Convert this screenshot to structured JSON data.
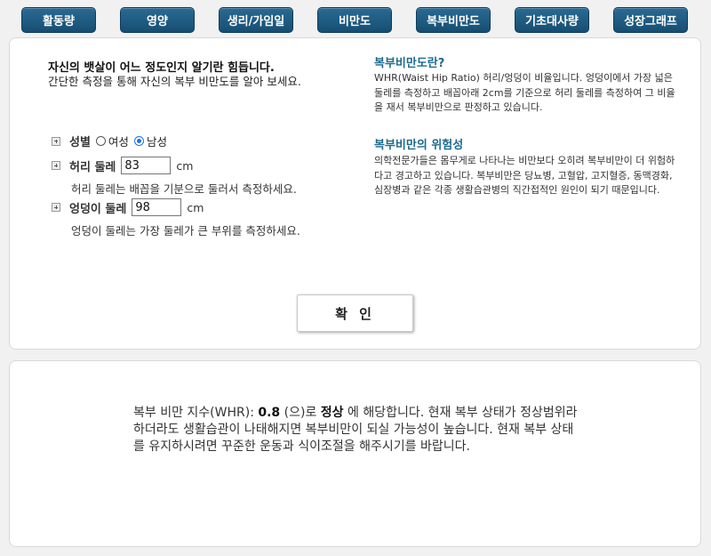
{
  "tabs": [
    "활동량",
    "영양",
    "생리/가임일",
    "비만도",
    "복부비만도",
    "기초대사량",
    "성장그래프"
  ],
  "intro": {
    "title": "자신의 뱃살이 어느 정도인지 알기란 힘듭니다.",
    "subtitle": "간단한 측정을 통해 자신의 복부 비만도를 알아 보세요."
  },
  "form": {
    "gender": {
      "label": "성별",
      "options": [
        "여성",
        "남성"
      ],
      "selected": "남성"
    },
    "waist": {
      "label": "허리 둘레",
      "value": "83",
      "unit": "cm",
      "hint": "허리 둘레는 배꼽을 기분으로 둘러서 측정하세요."
    },
    "hip": {
      "label": "엉덩이 둘레",
      "value": "98",
      "unit": "cm",
      "hint": "엉덩이 둘레는 가장 둘레가 큰 부위를 측정하세요."
    }
  },
  "info": {
    "whr_title": "복부비만도란?",
    "whr_text": "WHR(Waist Hip Ratio) 허리/엉덩이 비율입니다. 엉덩이에서 가장 넓은 둘레를 측정하고 배꼽아래 2cm를 기준으로 허리 둘레를 측정하여 그 비율을 재서 복부비만으로 판정하고 있습니다.",
    "risk_title": "복부비만의 위험성",
    "risk_text": "의학전문가들은 몸무게로 나타나는 비만보다 오히려 복부비만이 더 위험하다고 경고하고 있습니다. 복부비만은 당뇨병, 고혈압, 고지혈증, 동맥경화, 심장병과 같은 각종 생활습관병의 직간접적인 원인이 되기 때문입니다."
  },
  "confirm_label": "확 인",
  "result": {
    "prefix": "복부 비만 지수(WHR): ",
    "value": "0.8",
    "mid": " (으)로 ",
    "status": "정상",
    "suffix": " 에 해당합니다. 현재 복부 상태가 정상범위라 하더라도 생활습관이 나태해지면 복부비만이 되실 가능성이 높습니다. 현재 복부 상태를 유지하시려면 꾸준한 운동과 식이조절을 해주시기를 바랍니다."
  }
}
